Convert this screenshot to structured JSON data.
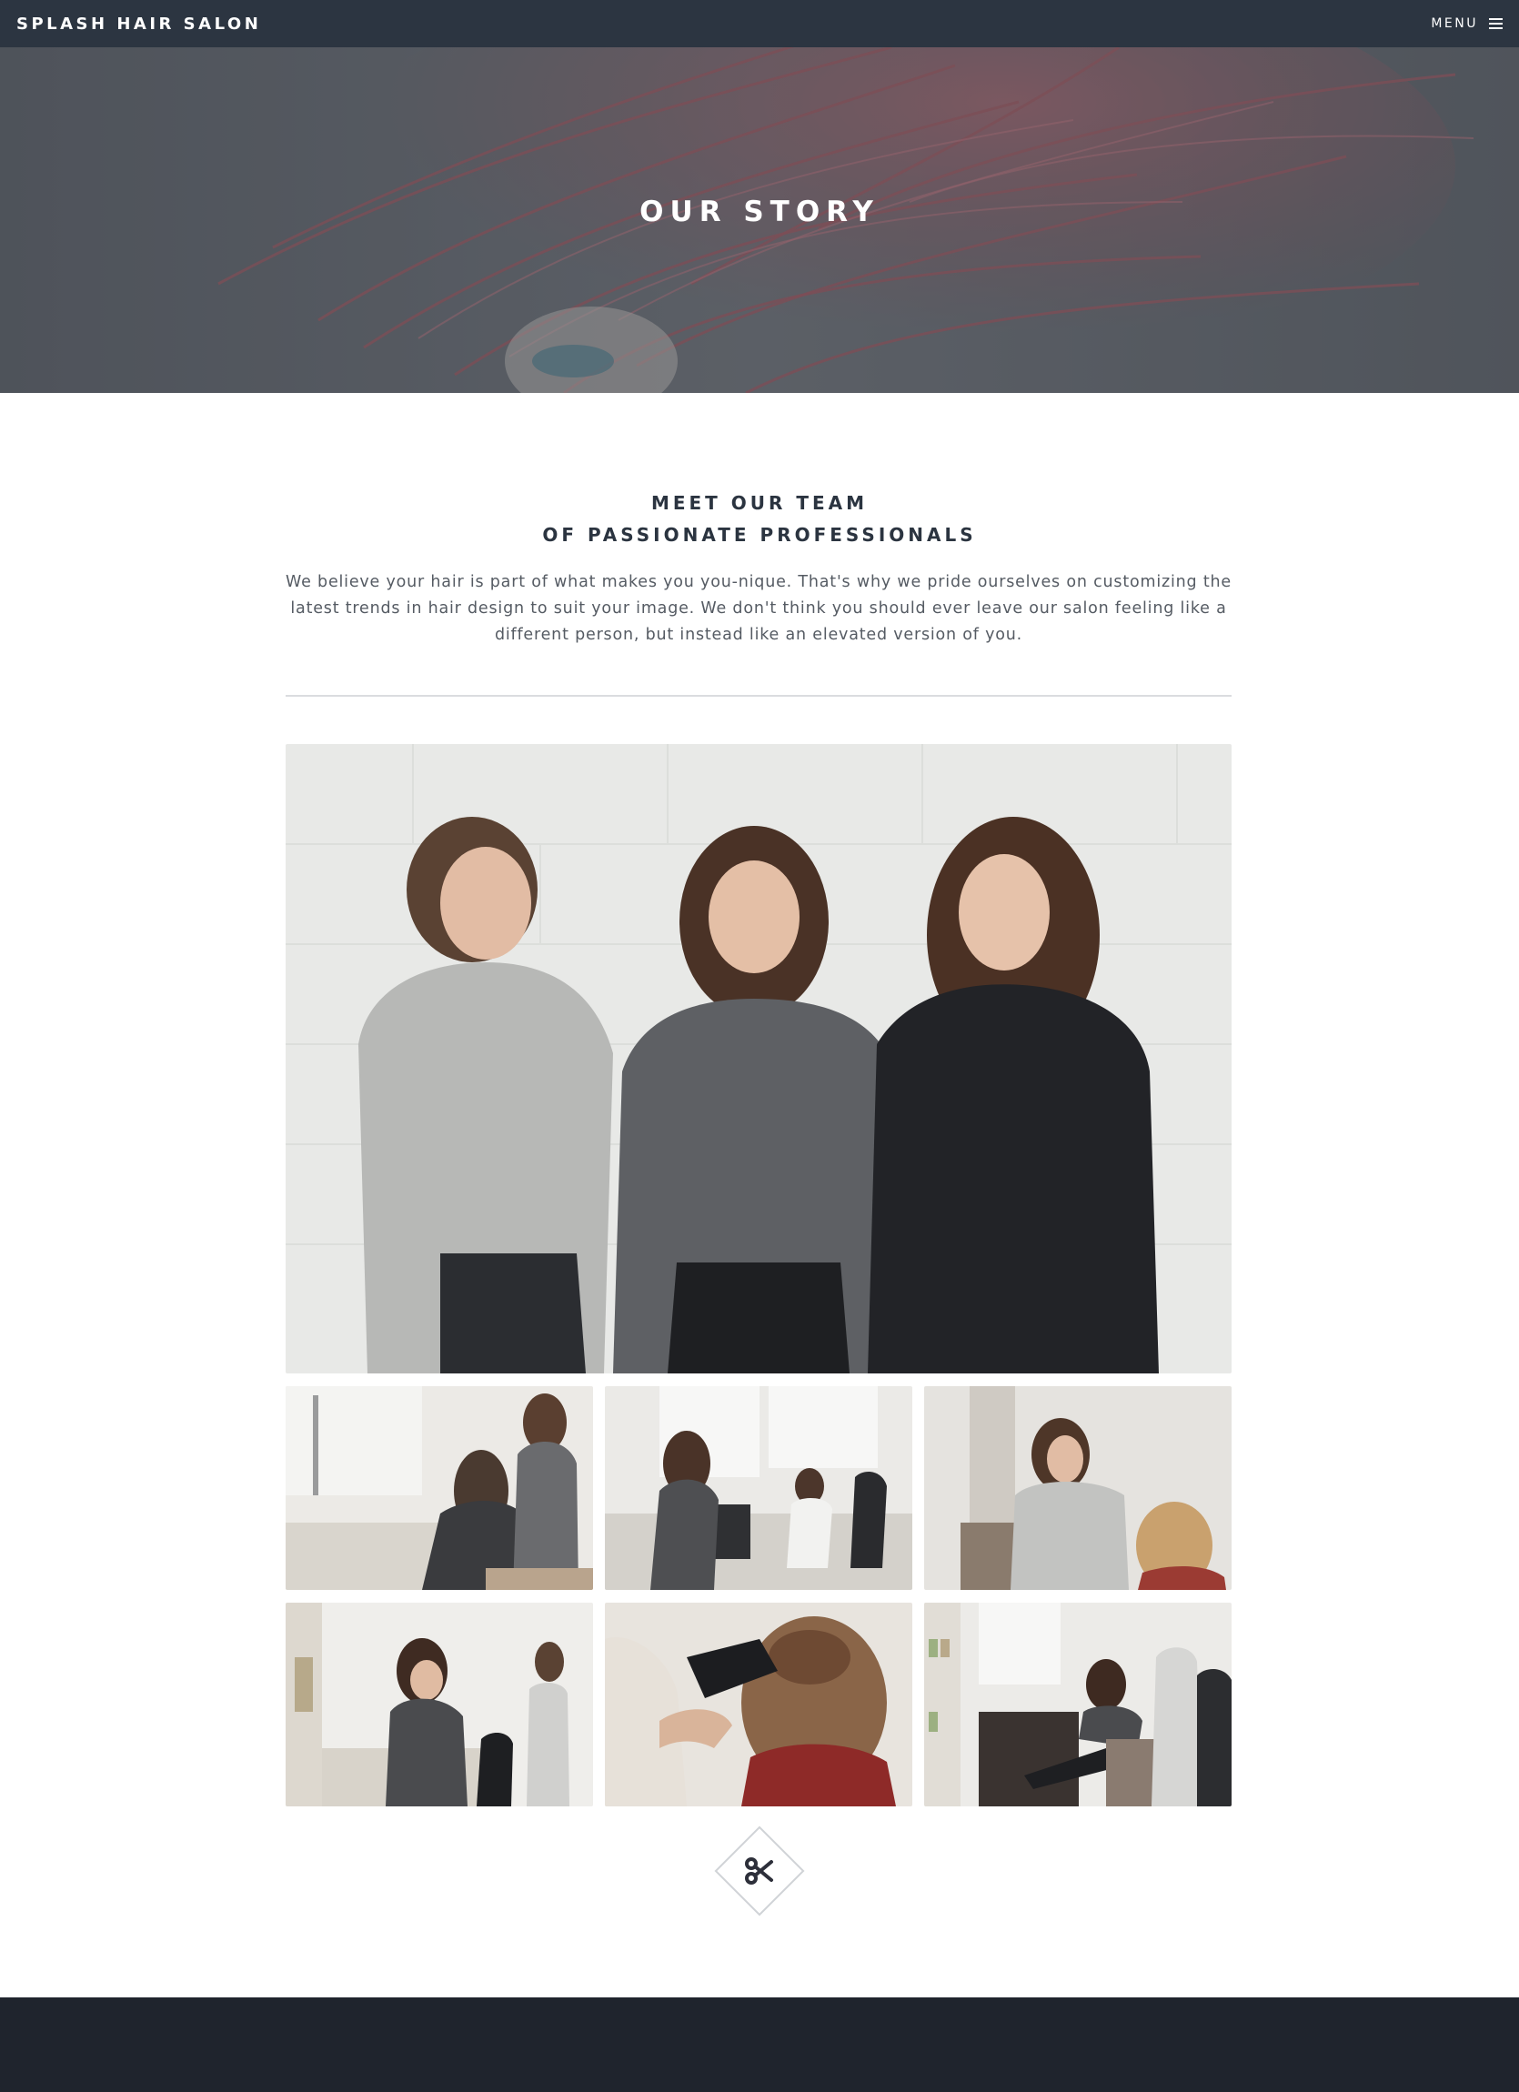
{
  "nav": {
    "brand": "SPLASH HAIR SALON",
    "menu_label": "MENU",
    "menu_icon": "hamburger-icon"
  },
  "hero": {
    "title": "OUR STORY",
    "image": "pink-hair-motion-photo"
  },
  "team": {
    "heading_line1": "MEET OUR TEAM",
    "heading_line2": "OF PASSIONATE PROFESSIONALS",
    "intro": "We believe your hair is part of what makes you you-nique. That's why we pride ourselves on customizing the latest trends in hair design to suit your image. We don't think you should ever leave our salon feeling like a different person, but instead like an elevated version of you."
  },
  "gallery": {
    "main_image": "three-stylists-team-photo",
    "thumbnails": [
      "stylist-with-client-at-mirror",
      "salon-floor-stylists-working",
      "stylist-spraying-client-hair",
      "stylist-at-counter-with-tablet",
      "blow-drying-client-hair",
      "stylist-laughing-in-chair"
    ]
  },
  "ornament": {
    "icon": "scissors-icon"
  },
  "colors": {
    "nav_bg": "#2c3541",
    "footer_bg": "#1f242d",
    "heading": "#2b3440",
    "body_text": "#555b63",
    "divider": "#dadcdf"
  }
}
